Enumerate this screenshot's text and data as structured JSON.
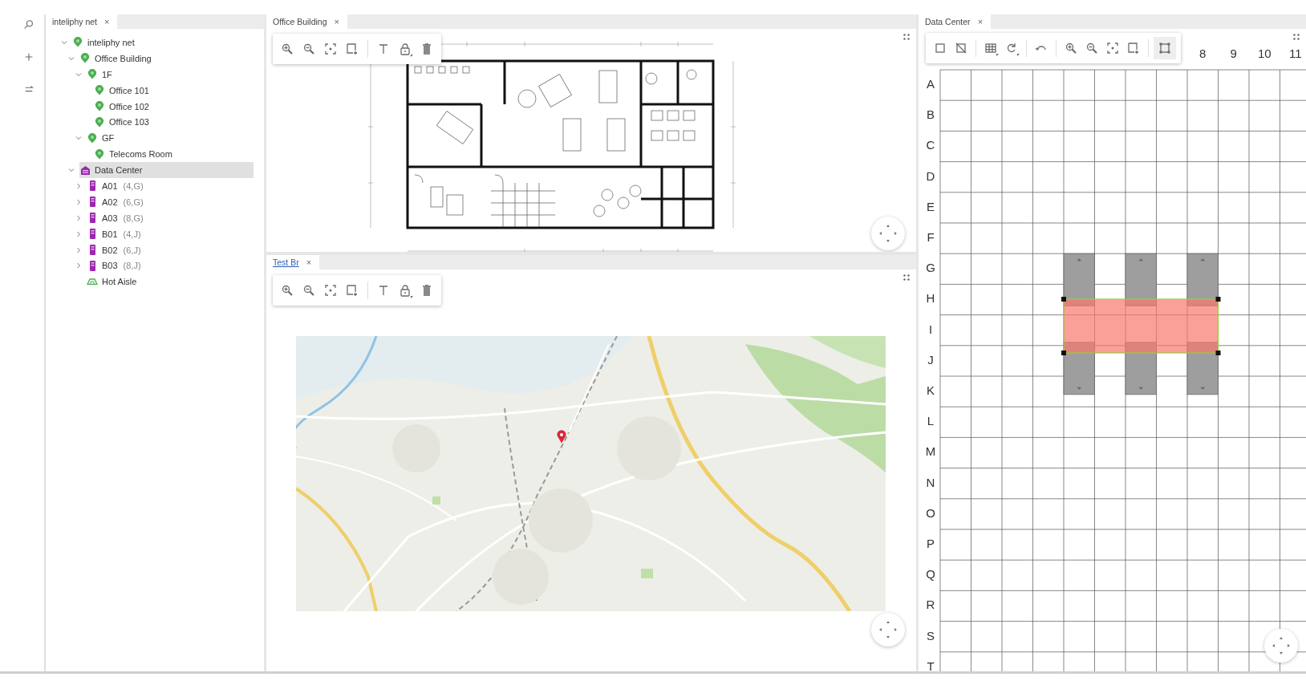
{
  "tree_panel": {
    "tab": {
      "label": "inteliphy net",
      "close": "×",
      "selected": true,
      "focused": false
    },
    "items": [
      {
        "label": "inteliphy net",
        "kind": "location",
        "expanded": true,
        "selected": false,
        "children": [
          {
            "label": "Office Building",
            "kind": "location",
            "expanded": true,
            "selected": false,
            "children": [
              {
                "label": "1F",
                "kind": "location",
                "expanded": true,
                "selected": false,
                "children": [
                  {
                    "label": "Office 101",
                    "kind": "location",
                    "selected": false
                  },
                  {
                    "label": "Office 102",
                    "kind": "location",
                    "selected": false
                  },
                  {
                    "label": "Office 103",
                    "kind": "location",
                    "selected": false
                  }
                ]
              },
              {
                "label": "GF",
                "kind": "location",
                "expanded": true,
                "selected": false,
                "children": [
                  {
                    "label": "Telecoms Room",
                    "kind": "location",
                    "selected": false
                  }
                ]
              }
            ]
          },
          {
            "label": "Data Center",
            "kind": "datacenter",
            "expanded": true,
            "selected": true,
            "children": [
              {
                "label": "A01",
                "coords": "(4,G)",
                "kind": "rack",
                "expanded": false,
                "selected": false
              },
              {
                "label": "A02",
                "coords": "(6,G)",
                "kind": "rack",
                "expanded": false,
                "selected": false
              },
              {
                "label": "A03",
                "coords": "(8,G)",
                "kind": "rack",
                "expanded": false,
                "selected": false
              },
              {
                "label": "B01",
                "coords": "(4,J)",
                "kind": "rack",
                "expanded": false,
                "selected": false
              },
              {
                "label": "B02",
                "coords": "(6,J)",
                "kind": "rack",
                "expanded": false,
                "selected": false
              },
              {
                "label": "B03",
                "coords": "(8,J)",
                "kind": "rack",
                "expanded": false,
                "selected": false
              },
              {
                "label": "Hot Aisle",
                "kind": "aisle",
                "selected": false
              }
            ]
          }
        ]
      }
    ]
  },
  "floor_plan_panel": {
    "tab": {
      "label": "Office Building",
      "close": "×",
      "selected": true,
      "focused": false
    }
  },
  "map_panel": {
    "tab": {
      "label": "Test Br",
      "close": "×",
      "selected": true,
      "focused": true
    }
  },
  "data_center_panel": {
    "tab": {
      "label": "Data Center",
      "close": "×",
      "selected": true,
      "focused": false
    },
    "frame_tool_on": true,
    "column_labels": [
      "8",
      "9",
      "10",
      "11"
    ],
    "row_labels": [
      "A",
      "B",
      "C",
      "D",
      "E",
      "F",
      "G",
      "H",
      "I",
      "J",
      "K",
      "L",
      "M",
      "N",
      "O",
      "P",
      "Q",
      "R",
      "S",
      "T"
    ],
    "aisle": {
      "selected": true
    }
  }
}
